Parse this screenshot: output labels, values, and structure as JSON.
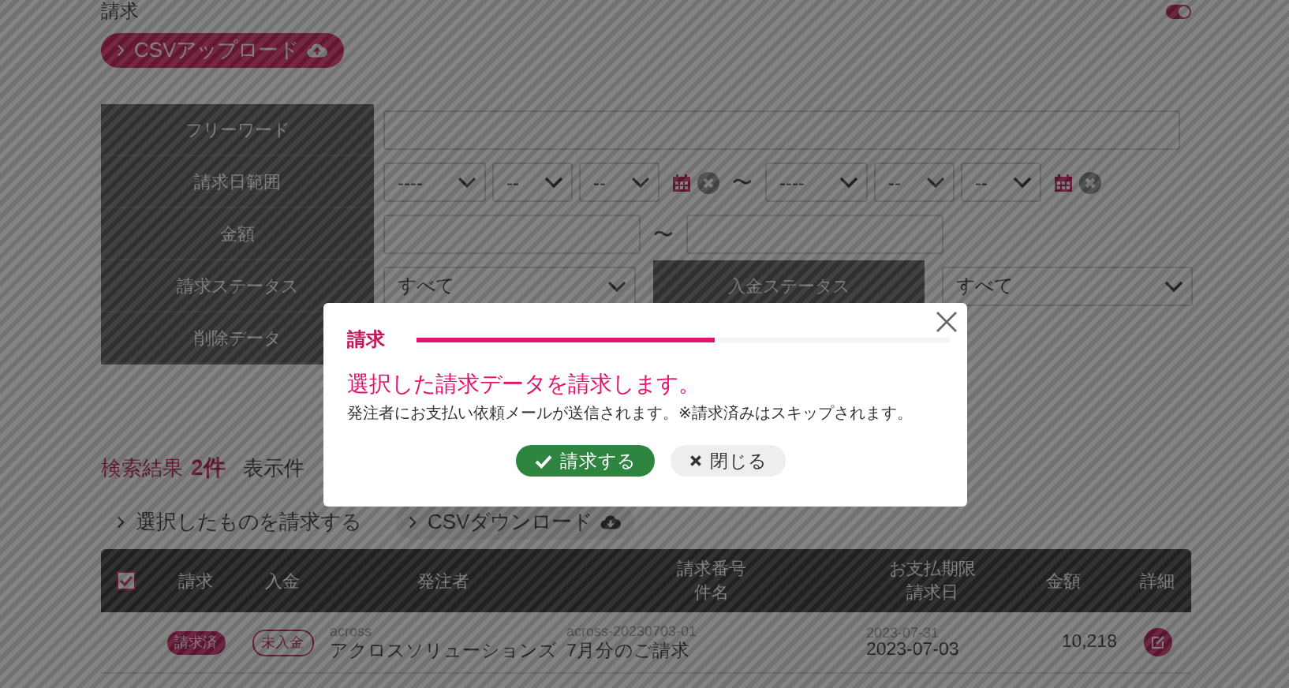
{
  "page_title": "請求",
  "toggle": {
    "on": true
  },
  "upload_button": {
    "label": "CSVアップロード"
  },
  "search_form": {
    "rows": [
      {
        "kind": "text",
        "label": "フリーワード"
      },
      {
        "kind": "date_range",
        "label": "請求日範囲",
        "from": [
          "----",
          "--",
          "--"
        ],
        "separator": "〜",
        "to": [
          "----",
          "--",
          "--"
        ]
      },
      {
        "kind": "amount_range",
        "label": "金額",
        "separator": "〜"
      },
      {
        "kind": "status",
        "label": "請求ステータス",
        "value": "すべて",
        "label_2": "入金ステータス",
        "value_2": "すべて"
      },
      {
        "kind": "plain",
        "label": "削除データ"
      }
    ]
  },
  "results": {
    "label": "検索結果",
    "count": "2件",
    "per_page_label": "表示件"
  },
  "actions": [
    {
      "label": "選択したものを請求する",
      "icon": false
    },
    {
      "label": "CSVダウンロード",
      "icon": true
    }
  ],
  "table": {
    "select_all": {
      "checked": true
    },
    "columns": [
      [
        "請求"
      ],
      [
        "入金"
      ],
      [
        "発注者"
      ],
      [
        "請求番号",
        "件名"
      ],
      [
        "お支払期限",
        "請求日"
      ],
      [
        "金額"
      ],
      [
        "詳細"
      ]
    ],
    "rows": [
      {
        "billing": "請求済",
        "payment": "未入金",
        "client_code": "across",
        "client": "アクロスソリューションズ",
        "number": "across-20230703-01",
        "subject": "7月分のご請求",
        "due": "2023-07-31",
        "date": "2023-07-03",
        "amount": "10,218"
      }
    ]
  },
  "modal": {
    "title": "請求",
    "level": 0.56,
    "message": "選択した請求データを請求します。",
    "note": "発注者にお支払い依頼メールが送信されます。※請求済みはスキップされます。",
    "buttons": [
      {
        "kind": "confirm",
        "label": "請求する"
      },
      {
        "kind": "close",
        "label": "閉じる"
      }
    ]
  }
}
